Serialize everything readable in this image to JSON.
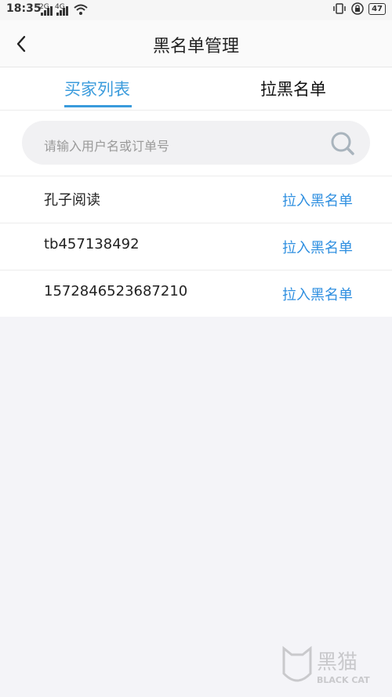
{
  "status": {
    "time": "18:35",
    "net1": "2G",
    "net2": "4G",
    "battery": "47"
  },
  "header": {
    "title": "黑名单管理"
  },
  "tabs": [
    {
      "label": "买家列表"
    },
    {
      "label": "拉黑名单"
    }
  ],
  "search": {
    "placeholder": "请输入用户名或订单号"
  },
  "users": [
    {
      "name": "孔子阅读",
      "action": "拉入黑名单"
    },
    {
      "name": "tb457138492",
      "action": "拉入黑名单"
    },
    {
      "name": "1572846523687210",
      "action": "拉入黑名单"
    }
  ],
  "watermark": {
    "main": "黑猫",
    "sub": "BLACK CAT"
  }
}
